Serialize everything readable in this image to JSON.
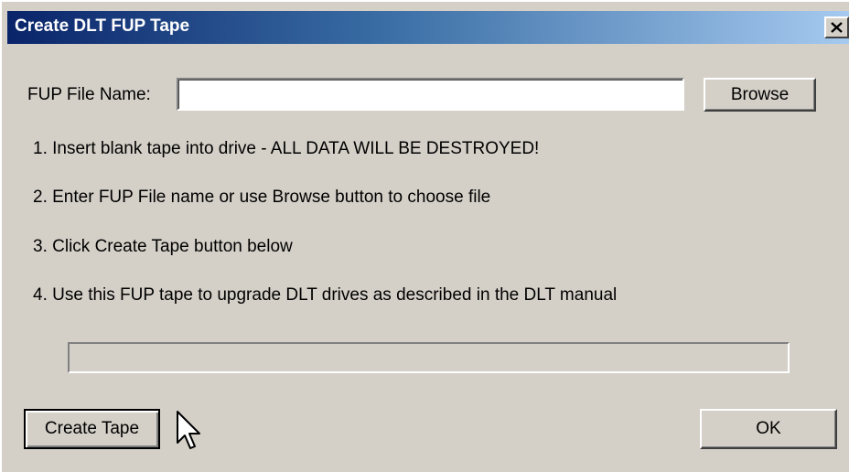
{
  "window": {
    "title": "Create DLT FUP Tape",
    "close_glyph": "✕"
  },
  "form": {
    "file_label": "FUP File Name:",
    "file_value": "",
    "file_placeholder": "",
    "browse_label": "Browse"
  },
  "instructions": [
    "1. Insert blank tape into drive - ALL DATA WILL BE DESTROYED!",
    "2. Enter FUP File name or use Browse button to choose file",
    "3. Click Create Tape button below",
    "4. Use this FUP tape to upgrade DLT drives as described in the DLT manual"
  ],
  "progress": {
    "value_fraction": 0
  },
  "buttons": {
    "create_label": "Create Tape",
    "ok_label": "OK"
  },
  "icons": {
    "close": "close-icon",
    "cursor": "mouse-pointer-icon"
  }
}
